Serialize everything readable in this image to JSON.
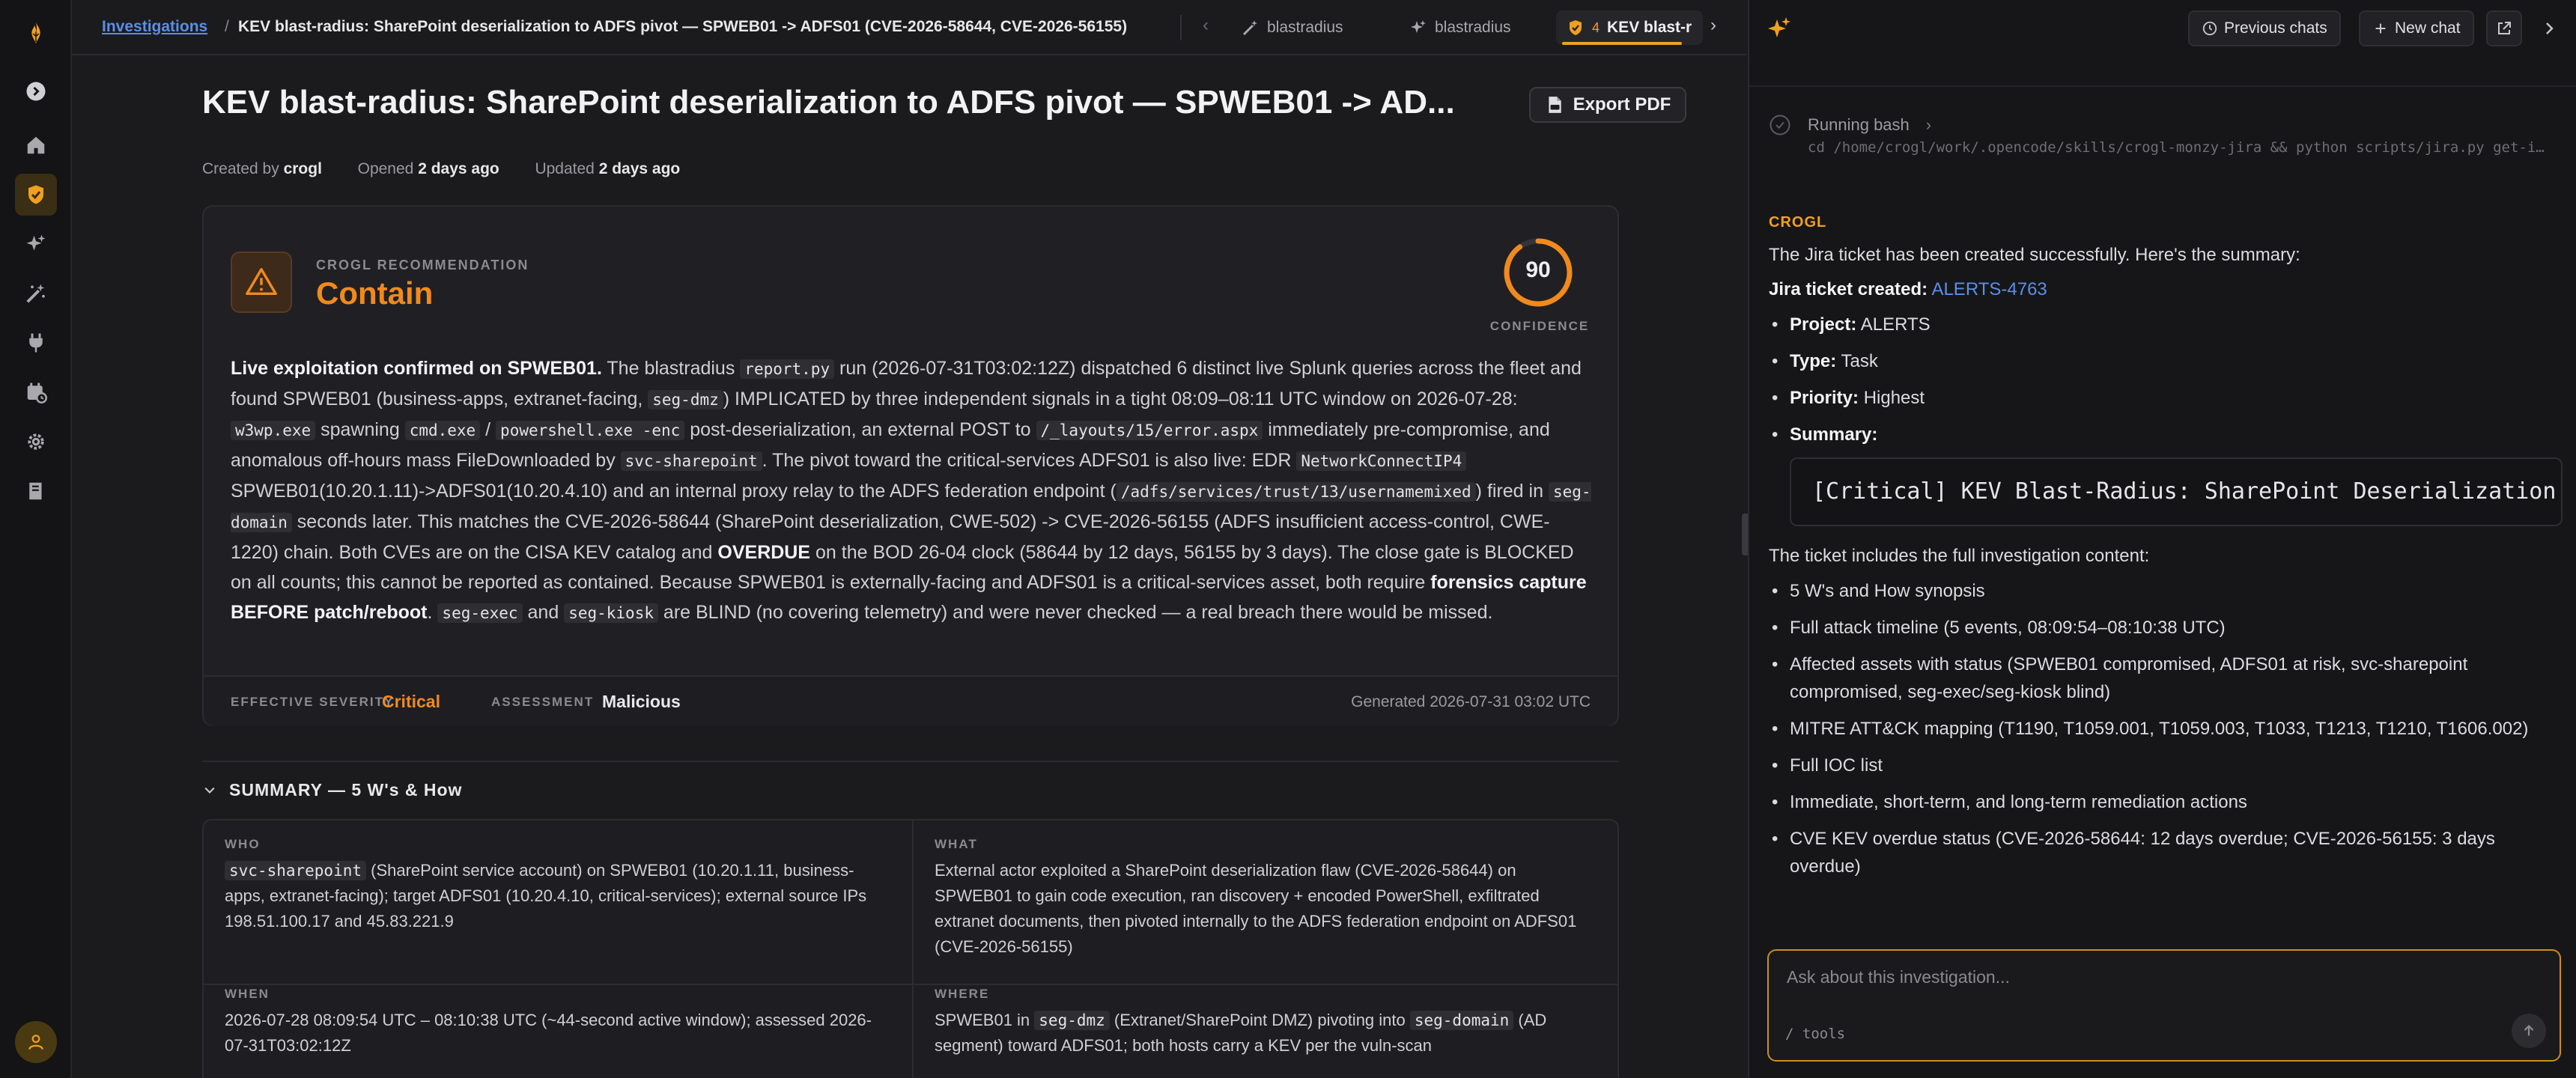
{
  "rail": {
    "items": [
      "collapse",
      "home",
      "investigations",
      "ai",
      "skills",
      "integrations",
      "schedules",
      "settings",
      "docs"
    ]
  },
  "breadcrumb": {
    "root": "Investigations",
    "separator": "/",
    "current": "KEV blast-radius: SharePoint deserialization to ADFS pivot — SPWEB01 -> ADFS01 (CVE-2026-58644, CVE-2026-56155)"
  },
  "tabs": [
    {
      "label": "blastradius"
    },
    {
      "label": "blastradius"
    },
    {
      "label": "KEV blast-r",
      "count": "4"
    }
  ],
  "page": {
    "title": "KEV blast-radius: SharePoint deserialization to ADFS pivot — SPWEB01 -> AD...",
    "export_label": "Export PDF",
    "meta": {
      "created_prefix": "Created by",
      "created_by": "crogl",
      "opened_prefix": "Opened",
      "opened": "2 days ago",
      "updated_prefix": "Updated",
      "updated": "2 days ago"
    }
  },
  "recommendation": {
    "label": "CROGL RECOMMENDATION",
    "value": "Contain",
    "confidence": 90,
    "confidence_label": "CONFIDENCE",
    "effective_severity_label": "EFFECTIVE SEVERITY",
    "effective_severity": "Critical",
    "assessment_label": "ASSESSMENT",
    "assessment": "Malicious",
    "generated": "Generated 2026-07-31 03:02 UTC",
    "colors": {
      "accent": "#f08a1c",
      "severity": "#f08a1c"
    }
  },
  "rec_body": {
    "s1": "Live exploitation confirmed on SPWEB01.",
    "s2": " The blastradius ",
    "c1": "report.py",
    "s3": " run (2026-07-31T03:02:12Z) dispatched 6 distinct live Splunk queries across the fleet and found SPWEB01 (business-apps, extranet-facing, ",
    "c2": "seg-dmz",
    "s4": ") IMPLICATED by three independent signals in a tight 08:09–08:11 UTC window on 2026-07-28: ",
    "c3": "w3wp.exe",
    "s5": " spawning ",
    "c4": "cmd.exe",
    "s6": " / ",
    "c5": "powershell.exe -enc",
    "s7": " post-deserialization, an external POST to ",
    "c6": "/_layouts/15/error.aspx",
    "s8": " immediately pre-compromise, and anomalous off-hours mass FileDownloaded by ",
    "c7": "svc-sharepoint",
    "s9": ". The pivot toward the critical-services ADFS01 is also live: EDR ",
    "c8": "NetworkConnectIP4",
    "s10": " SPWEB01(10.20.1.11)->ADFS01(10.20.4.10) and an internal proxy relay to the ADFS federation endpoint (",
    "c9": "/adfs/services/trust/13/usernamemixed",
    "s11": ") fired in ",
    "c10": "seg-domain",
    "s12": " seconds later. This matches the CVE-2026-58644 (SharePoint deserialization, CWE-502) -> CVE-2026-56155 (ADFS insufficient access-control, CWE-1220) chain. Both CVEs are on the CISA KEV catalog and ",
    "b1": "OVERDUE",
    "s13": " on the BOD 26-04 clock (58644 by 12 days, 56155 by 3 days). The close gate is BLOCKED on all counts; this cannot be reported as contained. Because SPWEB01 is externally-facing and ADFS01 is a critical-services asset, both require ",
    "b2": "forensics capture BEFORE patch/reboot",
    "s14": ". ",
    "c11": "seg-exec",
    "s15": " and ",
    "c12": "seg-kiosk",
    "s16": " are BLIND (no covering telemetry) and were never checked — a real breach there would be missed."
  },
  "summary": {
    "heading": "SUMMARY — 5 W's & How",
    "who_label": "WHO",
    "who_code": "svc-sharepoint",
    "who_text": " (SharePoint service account) on SPWEB01 (10.20.1.11, business-apps, extranet-facing); target ADFS01 (10.20.4.10, critical-services); external source IPs 198.51.100.17 and 45.83.221.9",
    "what_label": "WHAT",
    "what_text": "External actor exploited a SharePoint deserialization flaw (CVE-2026-58644) on SPWEB01 to gain code execution, ran discovery + encoded PowerShell, exfiltrated extranet documents, then pivoted internally to the ADFS federation endpoint on ADFS01 (CVE-2026-56155)",
    "when_label": "WHEN",
    "when_text": "2026-07-28 08:09:54 UTC – 08:10:38 UTC (~44-second active window); assessed 2026-07-31T03:02:12Z",
    "where_label": "WHERE",
    "where_t1": "SPWEB01 in ",
    "where_c1": "seg-dmz",
    "where_t2": " (Extranet/SharePoint DMZ) pivoting into ",
    "where_c2": "seg-domain",
    "where_t3": " (AD segment) toward ADFS01; both hosts carry a KEV per the vuln-scan"
  },
  "panel": {
    "previous_chats": "Previous chats",
    "new_chat": "New chat",
    "running_label": "Running bash",
    "bash_command": "cd /home/crogl/work/.opencode/skills/crogl-monzy-jira && python scripts/jira.py get-i…",
    "author": "CROGL",
    "intro": "The Jira ticket has been created successfully. Here's the summary:",
    "ticket_prefix": "Jira ticket created:",
    "ticket_id": "ALERTS-4763",
    "fields": [
      {
        "label": "Project:",
        "value": "ALERTS"
      },
      {
        "label": "Type:",
        "value": "Task"
      },
      {
        "label": "Priority:",
        "value": "Highest"
      },
      {
        "label": "Summary:",
        "value": ""
      }
    ],
    "summary_code": "[Critical] KEV Blast-Radius: SharePoint Deserialization to",
    "includes_text": "The ticket includes the full investigation content:",
    "includes": [
      "5 W's and How synopsis",
      "Full attack timeline (5 events, 08:09:54–08:10:38 UTC)",
      "Affected assets with status (SPWEB01 compromised, ADFS01 at risk, svc-sharepoint compromised, seg-exec/seg-kiosk blind)",
      "MITRE ATT&CK mapping (T1190, T1059.001, T1059.003, T1033, T1213, T1210, T1606.002)",
      "Full IOC list",
      "Immediate, short-term, and long-term remediation actions",
      "CVE KEV overdue status (CVE-2026-58644: 12 days overdue; CVE-2026-56155: 3 days overdue)"
    ],
    "input_placeholder": "Ask about this investigation...",
    "tools_hint": "/ tools"
  }
}
